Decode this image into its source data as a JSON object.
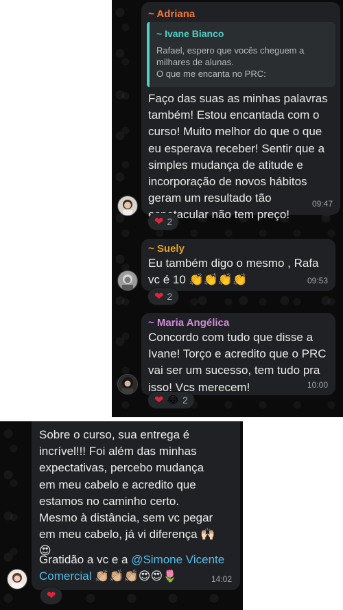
{
  "messages": [
    {
      "sender": "~ Adriana",
      "sender_color": "#f2763a",
      "quote": {
        "author": "~ Ivane Bianco",
        "text": "Rafael, espero que vocês cheguem a\nmilhares de alunas.\nO que me encanta no PRC:"
      },
      "text": "Faço das suas as minhas palavras\ntambém! Estou encantada com o\ncurso! Muito melhor do que o que\neu esperava receber! Sentir que a\nsimples mudança de atitude e\nincorporação de novos hábitos\ngeram um resultado tão\nespetacular não tem preço!",
      "time": "09:47",
      "reactions": {
        "emoji": "heart",
        "count": "2"
      }
    },
    {
      "sender": "~ Suely",
      "sender_color": "#e3a52d",
      "text": "Eu também digo o mesmo , Rafa\nvc é 10 👏👏👏👏",
      "time": "09:53",
      "reactions": {
        "emoji": "heart",
        "count": "2"
      }
    },
    {
      "sender": "~ Maria Angélica",
      "sender_color": "#d38bd9",
      "text": "Concordo com tudo que disse a\nIvane! Torço e acredito que o PRC\nvai ser um sucesso, tem tudo pra\nisso! Vcs merecem!",
      "time": "10:00",
      "reactions": {
        "emoji": "heart-laugh",
        "count": "2"
      }
    },
    {
      "text": "Sobre o curso, sua entrega é\nincrível!!! Foi além das minhas\nexpectativas, percebo mudança\nem meu cabelo e acredito que\nestamos no caminho certo.\nMesmo à distância, sem vc pegar\nem meu cabelo, já vi diferença 🙌🏻\n😍",
      "text_line2_prefix": "Gratidão a vc e a ",
      "mention": "@Simone Vicente Comercial",
      "mention_line1": "@Simone Vicente",
      "mention_line2": "Comercial",
      "trailing_emoji": " 👏🏼👏🏼👏🏼😍😍🌷",
      "time": "14:02",
      "reactions": {
        "emoji": "heart"
      }
    }
  ],
  "icons": {
    "heart": "❤",
    "laugh": "😂"
  },
  "colors": {
    "mention": "#53bdeb",
    "bubble": "#1f2124",
    "background": "#0b0b0b"
  }
}
